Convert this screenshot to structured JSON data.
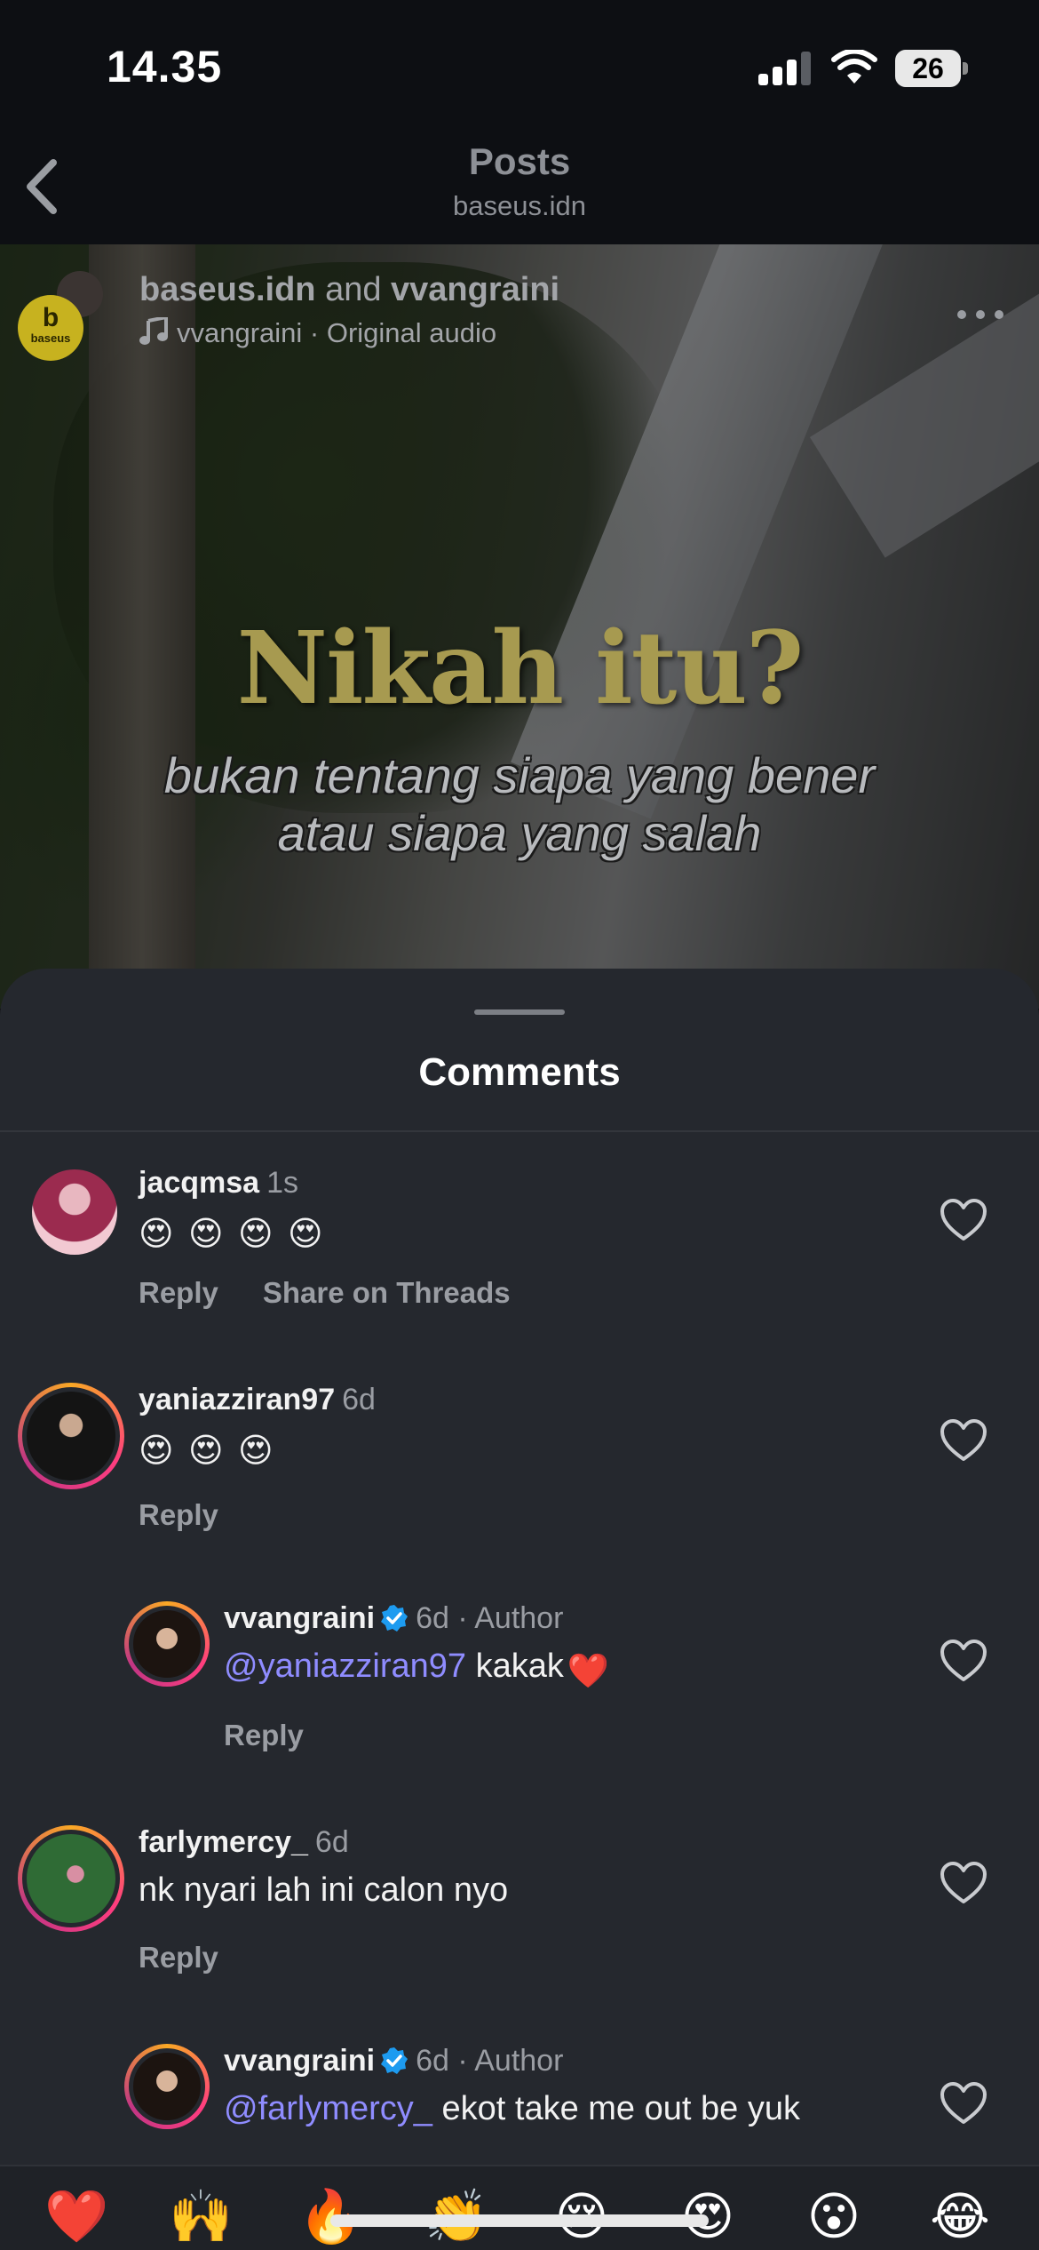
{
  "status_bar": {
    "time": "14.35",
    "battery": "26",
    "signal_icon": "cellular-signal-icon",
    "wifi_icon": "wifi-icon"
  },
  "nav": {
    "title": "Posts",
    "subtitle": "baseus.idn",
    "back_icon": "chevron-left-icon"
  },
  "post": {
    "avatar_text": "b",
    "avatar_wordmark": "baseus",
    "author1": "baseus.idn",
    "and": "and",
    "author2": "vvangraini",
    "audio": "vvangraini · Original audio",
    "overlay_title": "Nikah itu?",
    "overlay_line1": "bukan tentang siapa yang bener",
    "overlay_line2": "atau siapa yang salah",
    "more_icon": "more-horizontal-icon"
  },
  "sheet": {
    "title": "Comments"
  },
  "comments": [
    {
      "username": "jacqmsa",
      "time": "1s",
      "text": "",
      "emoji": [
        "😍",
        "😍",
        "😍",
        "😍"
      ],
      "reply": "Reply",
      "share": "Share on Threads"
    },
    {
      "username": "yaniazziran97",
      "time": "6d",
      "text": "",
      "emoji": [
        "😍",
        "😍",
        "😍"
      ],
      "reply": "Reply"
    },
    {
      "username": "vvangraini",
      "time": "6d · Author",
      "mention": "@yaniazziran97",
      "text": "kakak",
      "emoji": [
        "❤️"
      ],
      "reply": "Reply"
    },
    {
      "username": "farlymercy_",
      "time": "6d",
      "text": "nk nyari lah ini calon nyo",
      "reply": "Reply"
    },
    {
      "username": "vvangraini",
      "time": "6d · Author",
      "mention": "@farlymercy_",
      "text": "ekot take me out be yuk"
    }
  ],
  "reactions": [
    "❤️",
    "🙌",
    "🔥",
    "👏",
    "😢",
    "😍",
    "😮",
    "😂"
  ],
  "colors": {
    "accent_mention": "#8f8cff",
    "sheet_bg": "#25282e",
    "verified": "#1d9bf0",
    "overlay_title": "#a79a50"
  }
}
